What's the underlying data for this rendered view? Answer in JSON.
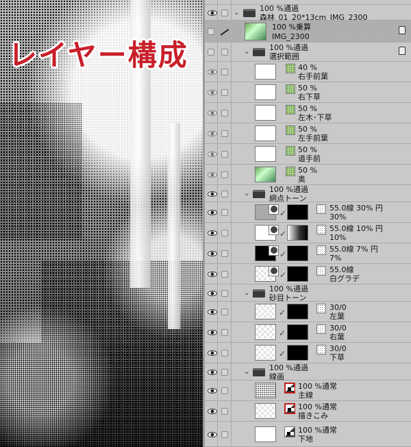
{
  "title": "レイヤー構成",
  "layers": [
    {
      "type": "group1",
      "eye": true,
      "line1": "100 %通過",
      "line2": "森林_01_20*13cm_IMG_2300"
    },
    {
      "type": "photo",
      "eye": false,
      "selected": true,
      "line1": "100 %乗算",
      "line2": "IMG_2300",
      "clip": true
    },
    {
      "type": "group2",
      "eye": false,
      "line1": "100 %通過",
      "line2": "選択範囲",
      "clip": true
    },
    {
      "type": "sel",
      "eye": true,
      "dim": true,
      "thumb": "white",
      "line1": "40 %",
      "line2": "右手前葉"
    },
    {
      "type": "sel",
      "eye": true,
      "dim": true,
      "thumb": "white",
      "line1": "50 %",
      "line2": "右下草"
    },
    {
      "type": "sel",
      "eye": true,
      "dim": true,
      "thumb": "white",
      "line1": "50 %",
      "line2": "左木･下草"
    },
    {
      "type": "sel",
      "eye": true,
      "dim": true,
      "thumb": "white",
      "line1": "50 %",
      "line2": "左手前葉"
    },
    {
      "type": "sel",
      "eye": true,
      "dim": true,
      "thumb": "white",
      "line1": "50 %",
      "line2": "道手前"
    },
    {
      "type": "sel",
      "eye": true,
      "dim": true,
      "thumb": "photo",
      "line1": "50 %",
      "line2": "奥"
    },
    {
      "type": "group2",
      "eye": true,
      "line1": "100 %通過",
      "line2": "網点トーン"
    },
    {
      "type": "tone",
      "eye": true,
      "thumb": "grey",
      "mask": "dark",
      "line1": "55.0線 30% 円",
      "line2": "30%"
    },
    {
      "type": "tone",
      "eye": true,
      "thumb": "white",
      "mask": "light",
      "line1": "55.0線 10% 円",
      "line2": "10%"
    },
    {
      "type": "tone",
      "eye": true,
      "thumb": "black",
      "mask": "dark",
      "line1": "55.0線 7% 円",
      "line2": "7%"
    },
    {
      "type": "tone",
      "eye": true,
      "thumb": "chk2",
      "mask": "dark",
      "line1": "55.0線",
      "line2": "白グラデ"
    },
    {
      "type": "group2",
      "eye": true,
      "line1": "100 %通過",
      "line2": "砂目トーン"
    },
    {
      "type": "sand",
      "eye": true,
      "thumb": "chk2",
      "line1": "30/0",
      "line2": "左葉"
    },
    {
      "type": "sand",
      "eye": true,
      "thumb": "chk2",
      "line1": "30/0",
      "line2": "右葉"
    },
    {
      "type": "sand",
      "eye": true,
      "thumb": "chk2",
      "line1": "30/0",
      "line2": "下草"
    },
    {
      "type": "group2",
      "eye": true,
      "line1": "100 %通過",
      "line2": "線画"
    },
    {
      "type": "raster",
      "eye": true,
      "thumb": "lines",
      "red": true,
      "line1": "100 %通常",
      "line2": "主線"
    },
    {
      "type": "raster",
      "eye": true,
      "thumb": "chk2",
      "red": true,
      "line1": "100 %通常",
      "line2": "描きこみ"
    },
    {
      "type": "raster",
      "eye": true,
      "thumb": "white",
      "red": false,
      "line1": "100 %通常",
      "line2": "下地"
    }
  ]
}
